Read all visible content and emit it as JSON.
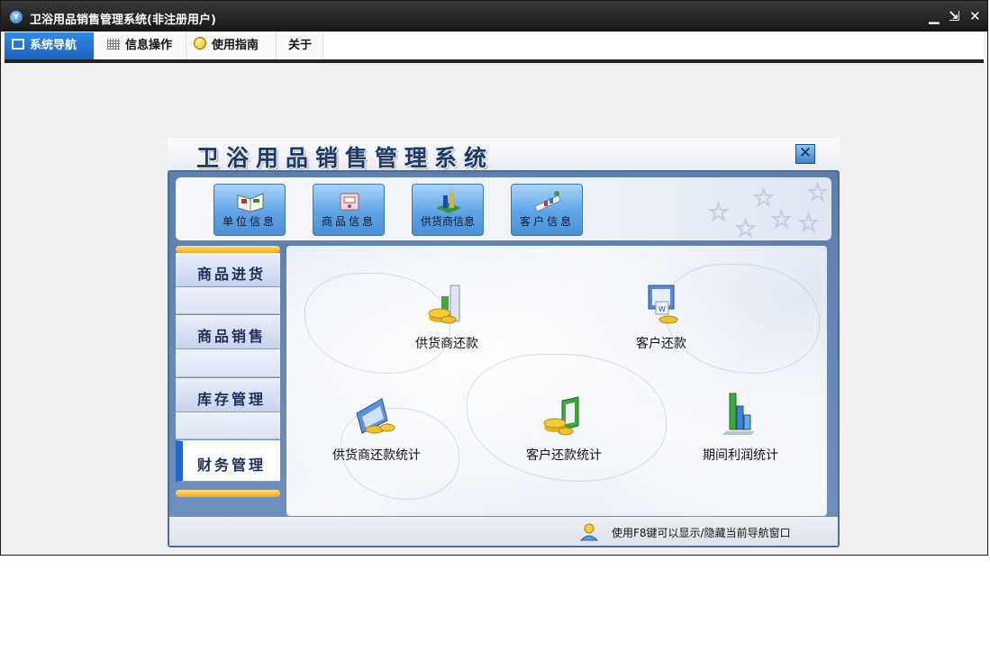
{
  "window": {
    "title": "卫浴用品销售管理系统(非注册用户)",
    "controls": {
      "minimize": "▁",
      "restore": "⇲",
      "close": "✕"
    }
  },
  "menu": {
    "tabs": [
      {
        "label": "系统导航",
        "icon": "monitor-icon",
        "active": true
      },
      {
        "label": "信息操作",
        "icon": "grid-icon",
        "active": false
      },
      {
        "label": "使用指南",
        "icon": "bulb-icon",
        "active": false
      },
      {
        "label": "关于",
        "icon": "",
        "active": false
      }
    ]
  },
  "panel": {
    "title": "卫浴用品销售管理系统",
    "close_label": "✕",
    "quick_buttons": [
      {
        "label": "单位信息",
        "icon": "book-icon"
      },
      {
        "label": "商品信息",
        "icon": "product-icon"
      },
      {
        "label": "供货商信息",
        "icon": "supplier-chart-icon"
      },
      {
        "label": "客户信息",
        "icon": "customer-icon"
      }
    ],
    "nav_groups": [
      {
        "label": "商品进货",
        "active": false
      },
      {
        "label": "商品销售",
        "active": false
      },
      {
        "label": "库存管理",
        "active": false
      },
      {
        "label": "财务管理",
        "active": true
      }
    ],
    "content_items": [
      {
        "label": "供货商还款",
        "icon": "supplier-repay-icon"
      },
      {
        "label": "客户还款",
        "icon": "customer-repay-icon"
      },
      {
        "label": "供货商还款统计",
        "icon": "supplier-stats-icon"
      },
      {
        "label": "客户还款统计",
        "icon": "customer-stats-icon"
      },
      {
        "label": "期间利润统计",
        "icon": "profit-chart-icon"
      }
    ],
    "status_text": "使用F8键可以显示/隐藏当前导航窗口"
  },
  "colors": {
    "titlebar": "#1c1c1c",
    "active_tab": "#1f6fd0",
    "panel_frame": "#5c7fb0",
    "nav_accent": "#1f66d1",
    "yellow_bar": "#f3a51c"
  }
}
